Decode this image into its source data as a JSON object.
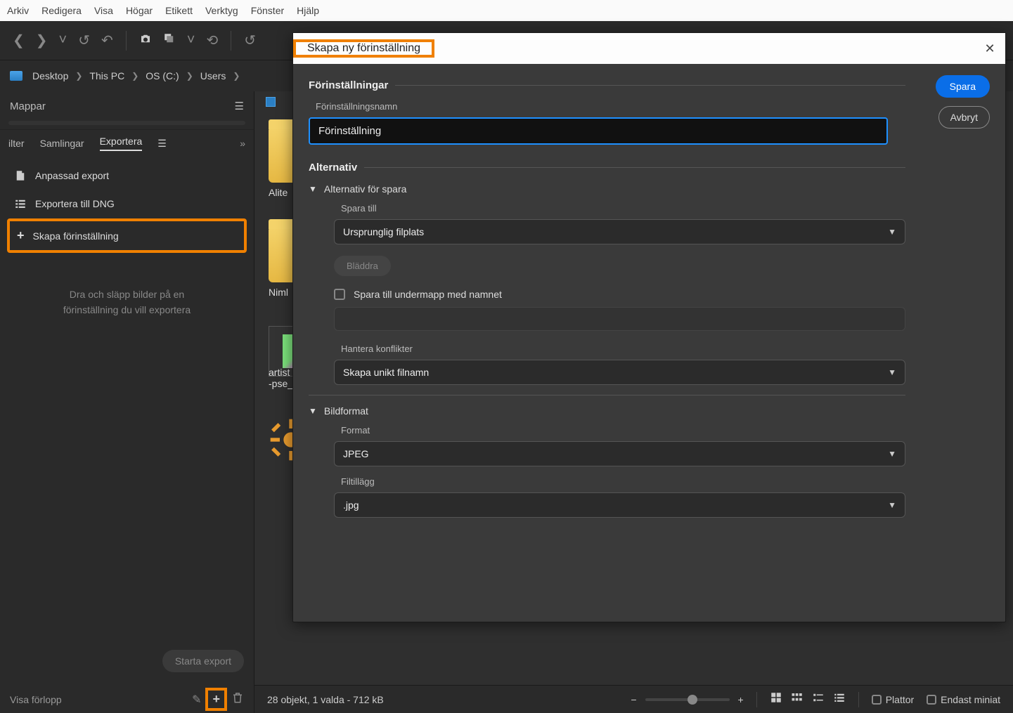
{
  "menubar": [
    "Arkiv",
    "Redigera",
    "Visa",
    "Högar",
    "Etikett",
    "Verktyg",
    "Fönster",
    "Hjälp"
  ],
  "breadcrumb": [
    "Desktop",
    "This PC",
    "OS (C:)",
    "Users"
  ],
  "sidebar": {
    "folders_label": "Mappar",
    "tabs": {
      "filter": "ilter",
      "collections": "Samlingar",
      "export": "Exportera"
    },
    "export_items": {
      "custom": "Anpassad export",
      "dng": "Exportera till DNG",
      "create": "Skapa förinställning"
    },
    "hint_line1": "Dra och släpp bilder på en",
    "hint_line2": "förinställning du vill exportera",
    "start_export": "Starta export",
    "show_progress": "Visa förlopp"
  },
  "content": {
    "label1": "Alite",
    "label2": "Niml",
    "label3a": "artist",
    "label3b": "-pse_"
  },
  "statusbar": {
    "text": "28 objekt, 1 valda - 712 kB",
    "plates": "Plattor",
    "thumbs_only": "Endast miniat"
  },
  "dialog": {
    "title": "Skapa ny förinställning",
    "save": "Spara",
    "cancel": "Avbryt",
    "sec_presets": "Förinställningar",
    "preset_name_label": "Förinställningsnamn",
    "preset_name_value": "Förinställning",
    "sec_options": "Alternativ",
    "sub_save": "Alternativ för spara",
    "save_to_label": "Spara till",
    "save_to_value": "Ursprunglig filplats",
    "browse": "Bläddra",
    "save_subfolder": "Spara till undermapp med namnet",
    "conflicts_label": "Hantera konflikter",
    "conflicts_value": "Skapa unikt filnamn",
    "sub_format": "Bildformat",
    "format_label": "Format",
    "format_value": "JPEG",
    "ext_label": "Filtillägg",
    "ext_value": ".jpg"
  }
}
